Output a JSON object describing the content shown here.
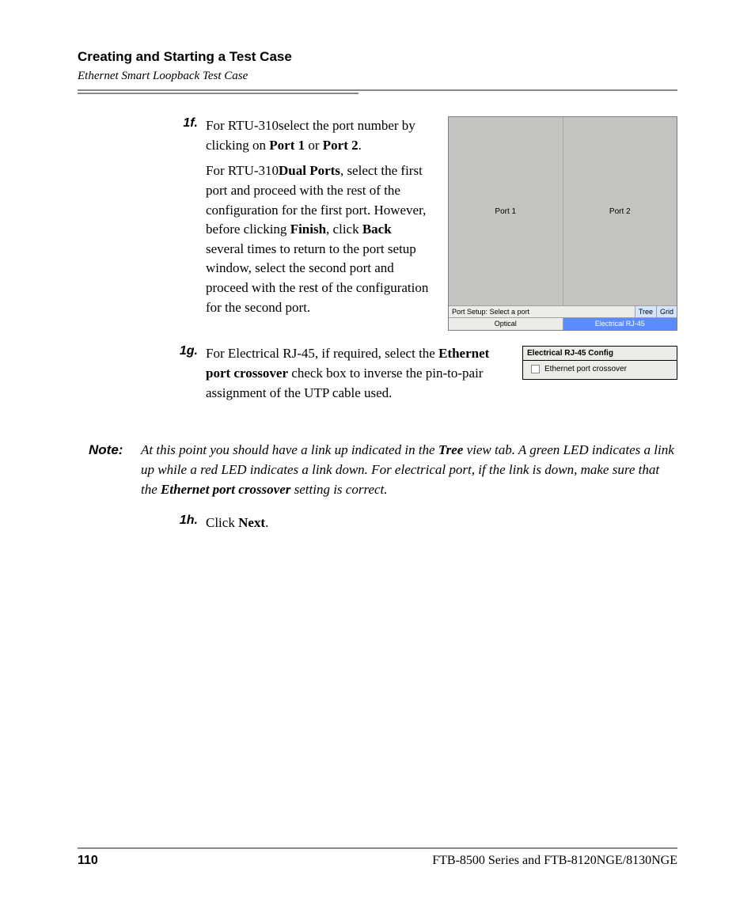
{
  "header": {
    "title": "Creating and Starting a Test Case",
    "subtitle": "Ethernet Smart Loopback Test Case"
  },
  "steps": {
    "s1f": {
      "label": "1f.",
      "p1_a": "For RTU-310select the port number by clicking on ",
      "p1_b1": "Port 1",
      "p1_or": " or ",
      "p1_b2": "Port 2",
      "p1_end": ".",
      "p2_a": "For RTU-310",
      "p2_b1": "Dual Ports",
      "p2_mid": ", select the first port and proceed with the rest of the configuration for the first port. However, before clicking ",
      "p2_b2": "Finish",
      "p2_mid2": ", click ",
      "p2_b3": "Back",
      "p2_tail": " several times to return to the port setup window, select the second port and proceed with the rest of the configuration for the second port."
    },
    "s1g": {
      "label": "1g.",
      "a": "For Electrical RJ-45, if required, select the ",
      "b": "Ethernet port crossover",
      "c": " check box to inverse the pin-to-pair assignment of the UTP cable used."
    },
    "s1h": {
      "label": "1h.",
      "a": "Click ",
      "b": "Next",
      "c": "."
    }
  },
  "note": {
    "label": "Note:",
    "a": "At this point you should have a link up indicated in the ",
    "b1": "Tree",
    "mid": " view tab. A green LED indicates a link up while a red LED indicates a link down. For electrical port, if the link is down, make sure that the ",
    "b2": "Ethernet port crossover",
    "tail": " setting is correct."
  },
  "port_ui": {
    "port1": "Port 1",
    "port2": "Port 2",
    "status": "Port Setup: Select a port",
    "tree": "Tree",
    "grid": "Grid",
    "tab_optical": "Optical",
    "tab_rj45": "Electrical RJ-45"
  },
  "rj45_ui": {
    "title": "Electrical RJ-45 Config",
    "checkbox_label": "Ethernet port crossover"
  },
  "footer": {
    "page": "110",
    "product": "FTB-8500 Series and FTB-8120NGE/8130NGE"
  }
}
